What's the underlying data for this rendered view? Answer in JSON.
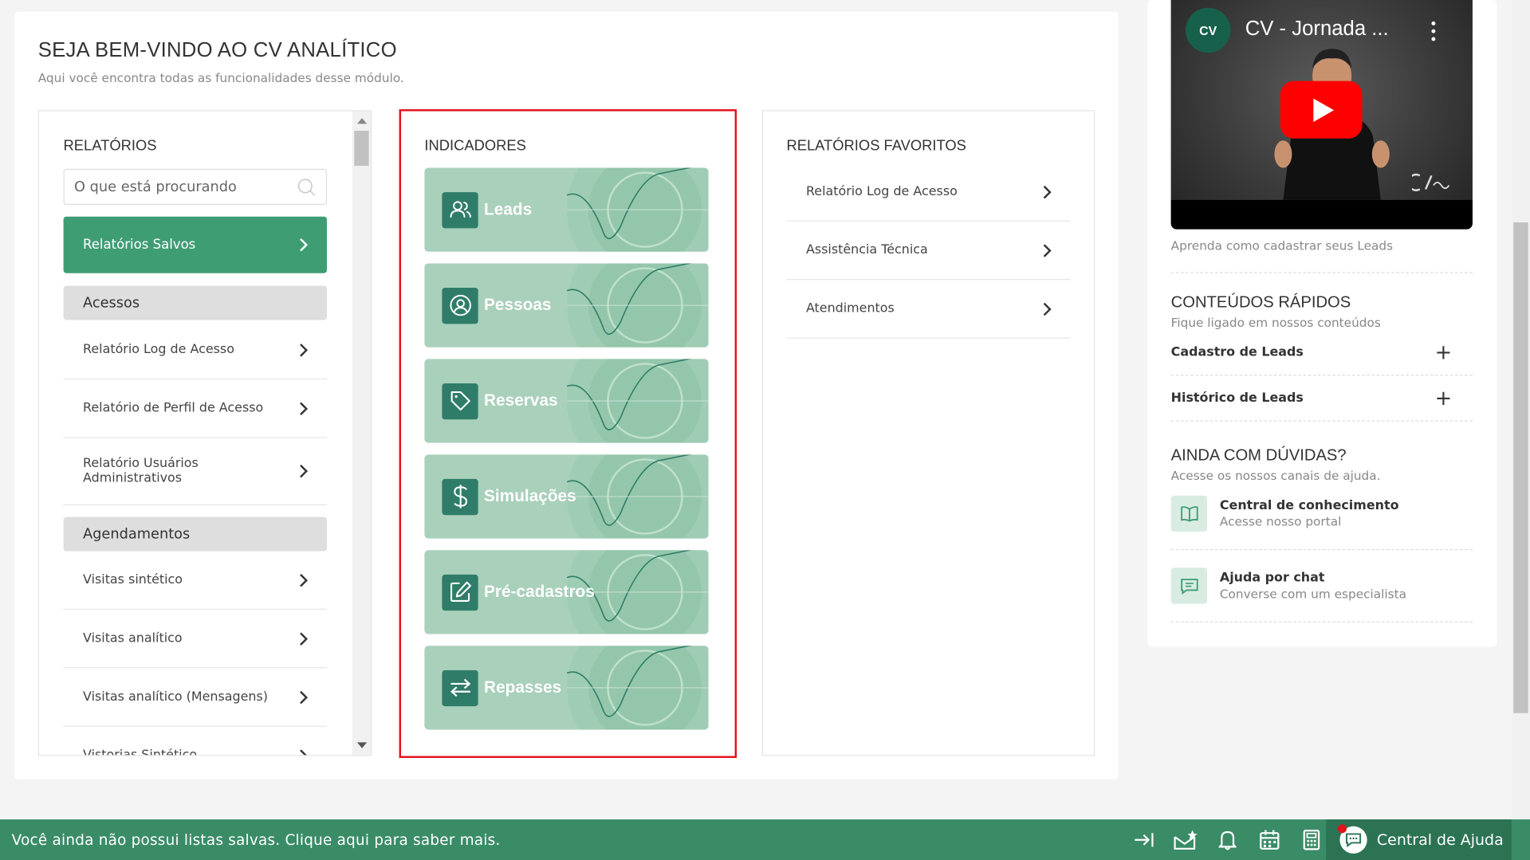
{
  "welcome": {
    "title": "SEJA BEM-VINDO AO CV ANALÍTICO",
    "subtitle": "Aqui você encontra todas as funcionalidades desse módulo."
  },
  "reports": {
    "title": "RELATÓRIOS",
    "search_placeholder": "O que está procurando",
    "saved_label": "Relatórios Salvos",
    "groups": [
      {
        "name": "Acessos",
        "items": [
          "Relatório Log de Acesso",
          "Relatório de Perfil de Acesso",
          "Relatório Usuários Administrativos"
        ]
      },
      {
        "name": "Agendamentos",
        "items": [
          "Visitas sintético",
          "Visitas analítico",
          "Visitas analítico (Mensagens)",
          "Vistorias Sintético"
        ]
      }
    ]
  },
  "indicators": {
    "title": "INDICADORES",
    "items": [
      {
        "label": "Leads",
        "icon": "users-icon"
      },
      {
        "label": "Pessoas",
        "icon": "user-circle-icon"
      },
      {
        "label": "Reservas",
        "icon": "tag-icon"
      },
      {
        "label": "Simulações",
        "icon": "dollar-icon"
      },
      {
        "label": "Pré-cadastros",
        "icon": "edit-icon"
      },
      {
        "label": "Repasses",
        "icon": "transfer-icon"
      }
    ]
  },
  "favorites": {
    "title": "RELATÓRIOS FAVORITOS",
    "items": [
      "Relatório Log de Acesso",
      "Assistência Técnica",
      "Atendimentos"
    ]
  },
  "video": {
    "logo": "CV",
    "title": "CV - Jornada ...",
    "caption": "Aprenda como cadastrar seus Leads"
  },
  "quick": {
    "title": "CONTEÚDOS RÁPIDOS",
    "subtitle": "Fique ligado em nossos conteúdos",
    "items": [
      "Cadastro de Leads",
      "Histórico de Leads"
    ]
  },
  "doubts": {
    "title": "AINDA COM DÚVIDAS?",
    "subtitle": "Acesse os nossos canais de ajuda.",
    "items": [
      {
        "title": "Central de conhecimento",
        "desc": "Acesse nosso portal",
        "icon": "book-icon"
      },
      {
        "title": "Ajuda por chat",
        "desc": "Converse com um especialista",
        "icon": "chat-icon"
      }
    ]
  },
  "bottom_bar": {
    "message": "Você ainda não possui listas salvas. Clique aqui para saber mais.",
    "help_label": "Central de Ajuda"
  },
  "colors": {
    "brand_green": "#3f9d74",
    "dark_green": "#2f7d68",
    "highlight_red": "#e3121b"
  }
}
